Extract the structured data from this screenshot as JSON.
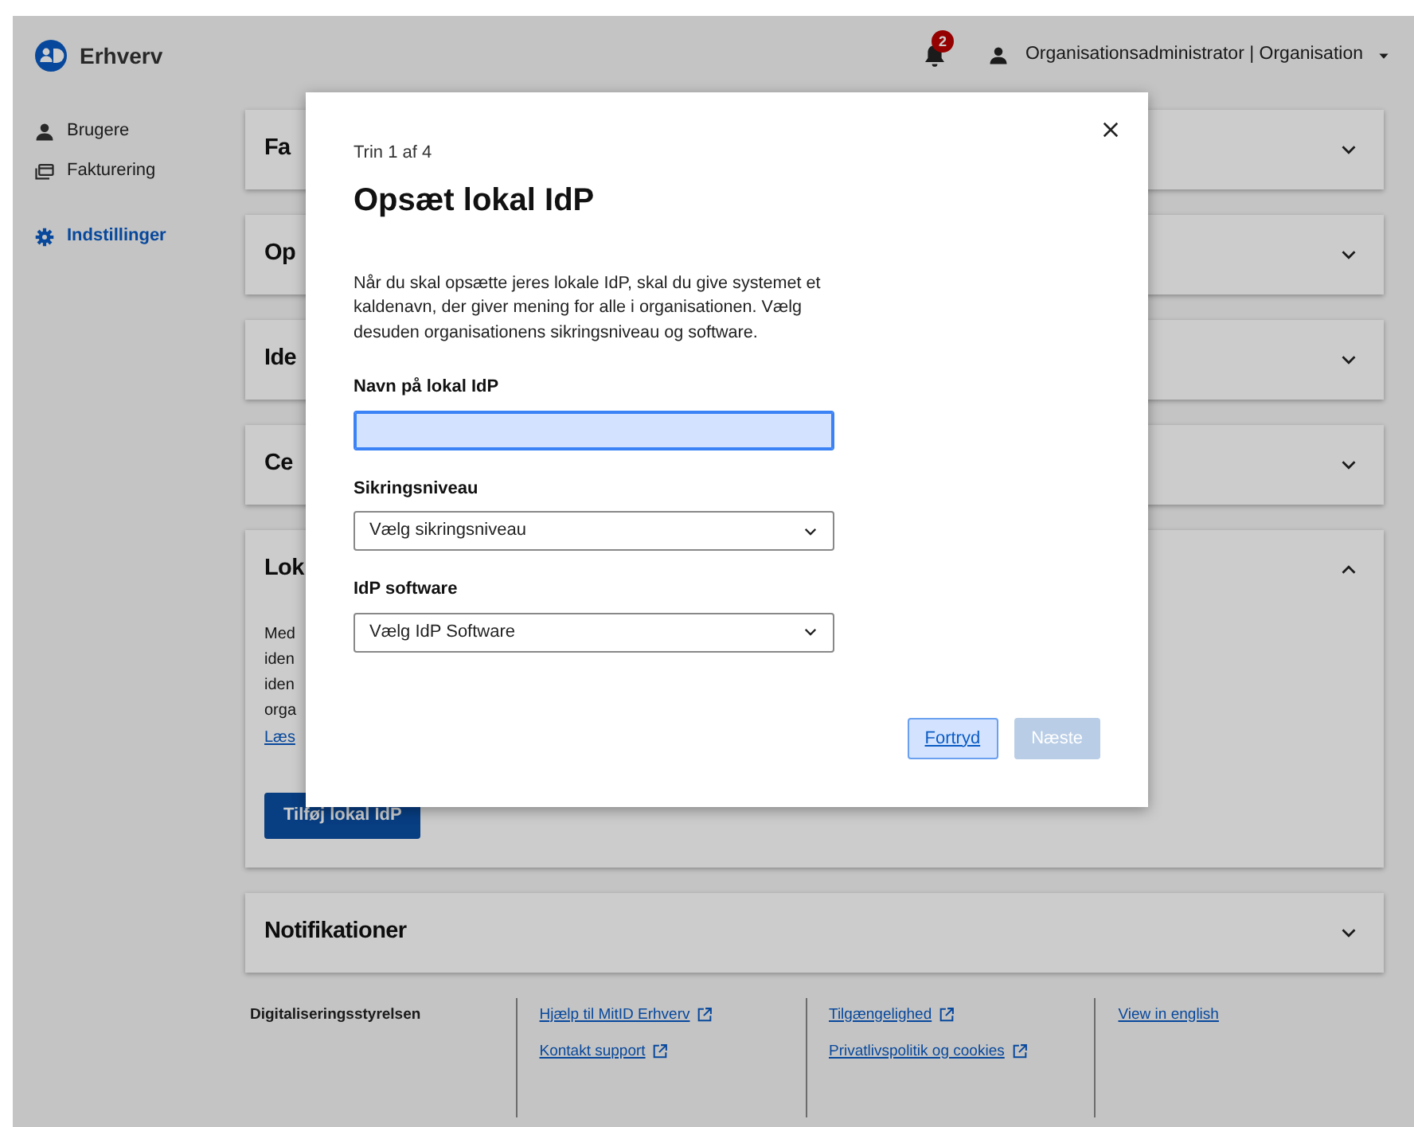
{
  "header": {
    "logo_text": "Erhverv",
    "notifications": {
      "count": "2"
    },
    "user": {
      "role": "Organisationsadministrator",
      "separator": "|",
      "organisation": "Organisation"
    }
  },
  "sidebar": {
    "groups": [
      [
        {
          "label": "Brugere",
          "kind": "user",
          "selected": false
        },
        {
          "label": "Fakturering",
          "kind": "billing",
          "selected": false
        }
      ],
      [
        {
          "label": "Indstillinger",
          "kind": "settings",
          "selected": true
        }
      ]
    ]
  },
  "accordions": [
    {
      "title": "Fa",
      "expanded": false
    },
    {
      "title": "Op",
      "expanded": false
    },
    {
      "title": "Ide",
      "expanded": false
    },
    {
      "title": "Ce",
      "expanded": false
    },
    {
      "title": "Lok",
      "expanded": true,
      "body_lines": [
        "Med",
        "iden",
        "iden",
        "orga"
      ],
      "link": "Læs",
      "button": "Tilføj lokal IdP"
    },
    {
      "title": "Notifikationer",
      "expanded": false
    }
  ],
  "footer": {
    "organisation": "Digitaliseringsstyrelsen",
    "columns": [
      [
        {
          "label": "Hjælp til MitID Erhverv",
          "external": true
        },
        {
          "label": "Kontakt support",
          "external": true
        }
      ],
      [
        {
          "label": "Tilgængelighed",
          "external": true
        },
        {
          "label": "Privatlivspolitik og cookies",
          "external": true
        }
      ],
      [
        {
          "label": "View in english",
          "external": false
        }
      ]
    ]
  },
  "modal": {
    "step": "Trin 1 af 4",
    "title": "Opsæt lokal IdP",
    "description": "Når du skal opsætte jeres lokale IdP, skal du give systemet et kaldenavn, der giver mening for alle i organisationen. Vælg desuden organisationens sikringsniveau og software.",
    "fields": [
      {
        "kind": "text",
        "label": "Navn på lokal IdP",
        "focused": true
      },
      {
        "kind": "select",
        "label": "Sikringsniveau",
        "value": "Vælg sikringsniveau",
        "focused": false
      },
      {
        "kind": "select",
        "label": "IdP software",
        "value": "Vælg IdP Software",
        "focused": false
      }
    ],
    "buttons": [
      {
        "label": "Fortryd",
        "kind": "secondary",
        "focused": true,
        "disabled": false
      },
      {
        "label": "Næste",
        "kind": "primary",
        "focused": false,
        "disabled": true
      }
    ]
  }
}
